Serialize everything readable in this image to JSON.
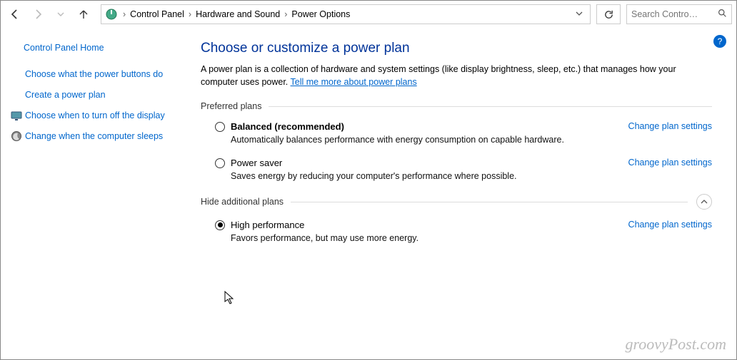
{
  "breadcrumb": {
    "items": [
      "Control Panel",
      "Hardware and Sound",
      "Power Options"
    ]
  },
  "search": {
    "placeholder": "Search Contro…"
  },
  "sidebar": {
    "home": "Control Panel Home",
    "items": [
      "Choose what the power buttons do",
      "Create a power plan",
      "Choose when to turn off the display",
      "Change when the computer sleeps"
    ]
  },
  "content": {
    "title": "Choose or customize a power plan",
    "intro_pre": "A power plan is a collection of hardware and system settings (like display brightness, sleep, etc.) that manages how your computer uses power. ",
    "intro_link": "Tell me more about power plans",
    "section_preferred": "Preferred plans",
    "section_additional": "Hide additional plans",
    "change_label": "Change plan settings",
    "plans": [
      {
        "name": "Balanced (recommended)",
        "desc": "Automatically balances performance with energy consumption on capable hardware.",
        "bold": true,
        "selected": false
      },
      {
        "name": "Power saver",
        "desc": "Saves energy by reducing your computer's performance where possible.",
        "bold": false,
        "selected": false
      }
    ],
    "additional_plans": [
      {
        "name": "High performance",
        "desc": "Favors performance, but may use more energy.",
        "bold": false,
        "selected": true
      }
    ]
  },
  "help_badge": "?",
  "watermark": "groovyPost.com"
}
